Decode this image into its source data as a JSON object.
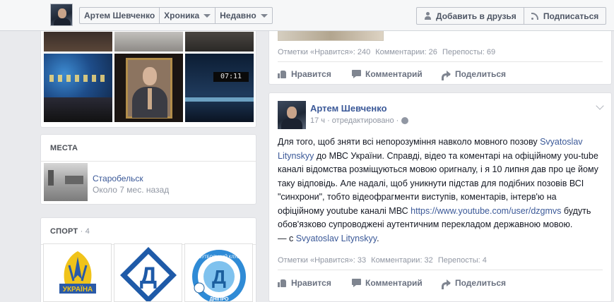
{
  "header": {
    "profile_name": "Артем Шевченко",
    "timeline_label": "Хроника",
    "recent_label": "Недавно",
    "add_friend_label": "Добавить в друзья",
    "subscribe_label": "Подписаться"
  },
  "photos": {
    "board_text": "07:11"
  },
  "places": {
    "title": "МЕСТА",
    "item": {
      "name": "Старобельск",
      "time": "Около 7 мес. назад"
    }
  },
  "sport": {
    "title": "СПОРТ",
    "count": "· 4",
    "logos": [
      {
        "name": "ukraina-crest-icon",
        "text": "УКРАЇНА"
      },
      {
        "name": "dynamo-logo-icon",
        "text": "Д"
      },
      {
        "name": "dnipro-football-club-icon",
        "text": "ФУТБОЛЬНИЙ КЛУБ",
        "text2": "Д",
        "text3": "ДНІПРО"
      }
    ]
  },
  "post1": {
    "likes": "Отметки «Нравится»: 240",
    "comments": "Комментарии: 26",
    "shares": "Перепосты: 69",
    "like_label": "Нравится",
    "comment_label": "Комментарий",
    "share_label": "Поделиться"
  },
  "post2": {
    "author": "Артем Шевченко",
    "meta": "17 ч · отредактировано ·",
    "text_parts": {
      "p1": "Для того, щоб зняти всі непорозуміння навколо мовного позову ",
      "link1": "Svyatoslav Litynskyy",
      "p2": " до МВС України. Справді, відео та коментарі на офіційному you-tube каналі відомства розміщуються мовою оригналу, і я 10 липня дав про це йому таку відповідь. Але надалі, щоб уникнути підстав для подібних позовів ВСІ \"синхрони\", тобто відеофрагменти виступів, коментарів, інтерв'ю на офіційному youtube каналі МВС ",
      "link2": "https://www.youtube.com/user/dzgmvs",
      "p3": " будуть обов'язково супроводжені аутентичним перекладом державною мовою.",
      "with_prefix": "— с ",
      "link3": "Svyatoslav Litynskyy",
      "with_suffix": "."
    },
    "likes": "Отметки «Нравится»: 33",
    "comments": "Комментарии: 32",
    "shares": "Перепосты: 4",
    "like_label": "Нравится",
    "comment_label": "Комментарий",
    "share_label": "Поделиться"
  },
  "colors": {
    "link": "#3b5998",
    "muted": "#9197a3",
    "background": "#e9eaed"
  }
}
